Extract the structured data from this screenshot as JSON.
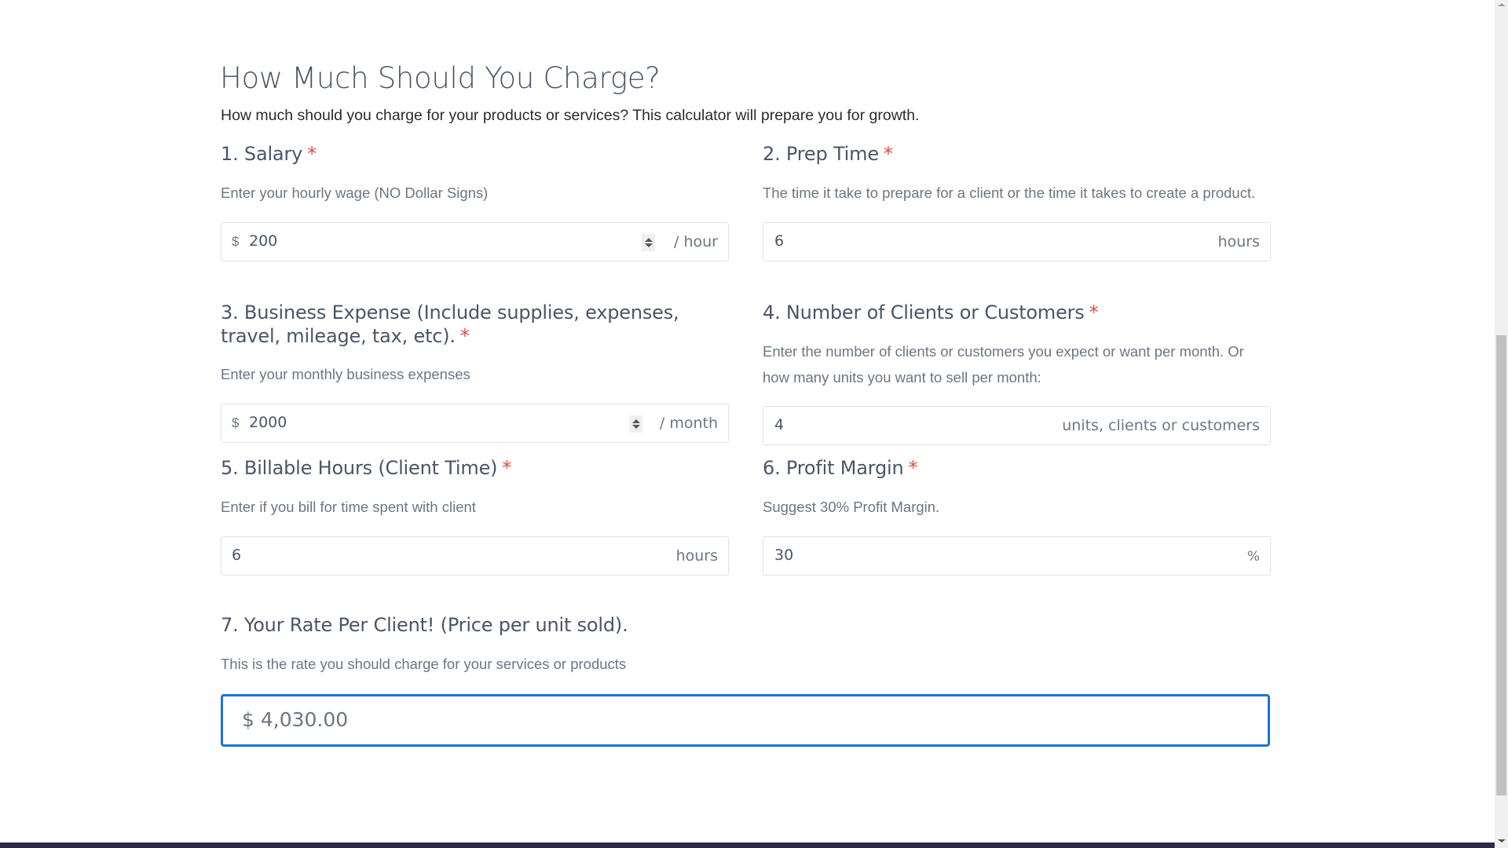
{
  "page": {
    "title": "How Much Should You Charge?",
    "subtitle": "How much should you charge for your products or services? This calculator will prepare you for growth.",
    "required_marker": "*"
  },
  "fields": [
    {
      "label": "1. Salary",
      "required": true,
      "help": "Enter your hourly wage (NO Dollar Signs)",
      "prefix": "$",
      "value": "200",
      "suffix": "/ hour",
      "has_spinner": true
    },
    {
      "label": "2. Prep Time",
      "required": true,
      "help": "The time it take to prepare for a client or the time it takes to create a product.",
      "value": "6",
      "suffix": "hours"
    },
    {
      "label": "3. Business Expense (Include supplies, expenses, travel, mileage, tax, etc).",
      "required": true,
      "help": "Enter your monthly business expenses",
      "prefix": "$",
      "value": "2000",
      "suffix": "/ month",
      "has_spinner": true
    },
    {
      "label": "4. Number of Clients or Customers",
      "required": true,
      "help": "Enter the number of clients or customers you expect or want per month. Or how many units you want to sell per month:",
      "value": "4",
      "suffix": "units, clients or customers"
    },
    {
      "label": "5. Billable Hours (Client Time)",
      "required": true,
      "help": "Enter if you bill for time spent with client",
      "value": "6",
      "suffix": "hours"
    },
    {
      "label": "6. Profit Margin",
      "required": true,
      "help": "Suggest 30% Profit Margin.",
      "value": "30",
      "suffix": "%"
    }
  ],
  "result": {
    "label": "7. Your Rate Per Client! (Price per unit sold).",
    "help": "This is the rate you should charge for your services or products",
    "value": "$ 4,030.00"
  },
  "colors": {
    "heading": "#4b5568",
    "required": "#e24c3d",
    "result_border": "#1a73d9",
    "footer_band": "#2c2a4a"
  }
}
